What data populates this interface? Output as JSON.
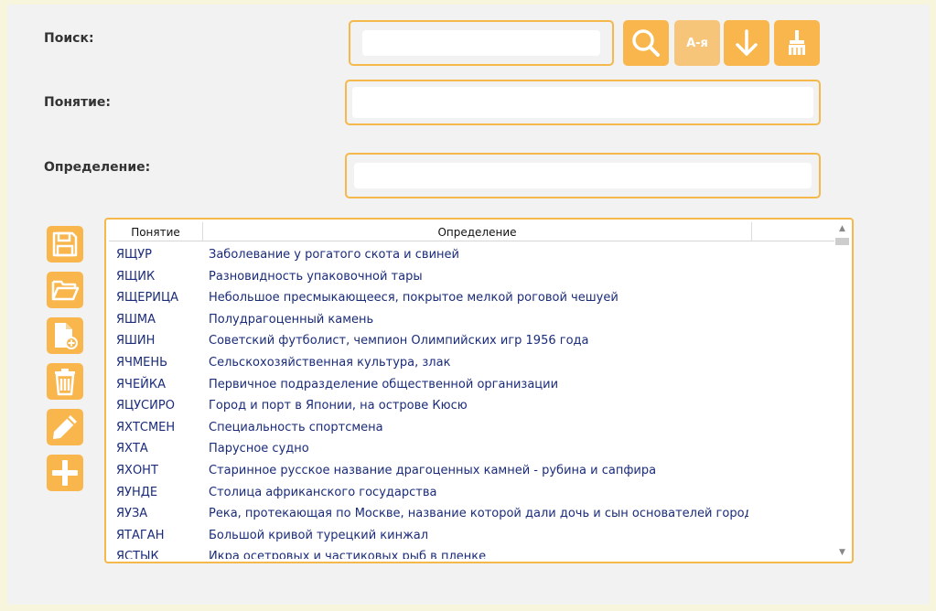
{
  "labels": {
    "search": "Поиск:",
    "concept": "Понятие:",
    "definition": "Определение:"
  },
  "inputs": {
    "search_value": "",
    "concept_value": "",
    "definition_value": ""
  },
  "toolbar": {
    "sort_label": "А-я",
    "search_icon": "magnifier-icon",
    "download_icon": "arrow-down-icon",
    "clear_icon": "broom-icon"
  },
  "sidebar_icons": [
    "save-icon",
    "open-folder-icon",
    "new-file-icon",
    "trash-icon",
    "pencil-icon",
    "plus-icon"
  ],
  "table": {
    "columns": [
      "Понятие",
      "Определение"
    ],
    "rows": [
      {
        "term": "ЯЩУР",
        "def": "Заболевание у рогатого скота и свиней"
      },
      {
        "term": "ЯЩИК",
        "def": "Разновидность упаковочной тары"
      },
      {
        "term": "ЯЩЕРИЦА",
        "def": "Небольшое пресмыкающееся, покрытое мелкой роговой чешуей"
      },
      {
        "term": "ЯШМА",
        "def": "Полудрагоценный камень"
      },
      {
        "term": "ЯШИН",
        "def": "Советский футболист, чемпион Олимпийских игр 1956 года"
      },
      {
        "term": "ЯЧМЕНЬ",
        "def": "Сельскохозяйственная культура, злак"
      },
      {
        "term": "ЯЧЕЙКА",
        "def": "Первичное подразделение общественной организации"
      },
      {
        "term": "ЯЦУСИРО",
        "def": "Город и порт в Японии, на острове Кюсю"
      },
      {
        "term": "ЯХТСМЕН",
        "def": "Специальность спортсмена"
      },
      {
        "term": "ЯХТА",
        "def": "Парусное судно"
      },
      {
        "term": "ЯХОНТ",
        "def": "Старинное русское название драгоценных камней - рубина и сапфира"
      },
      {
        "term": "ЯУНДЕ",
        "def": "Столица африканского государства"
      },
      {
        "term": "ЯУЗА",
        "def": "Река, протекающая по Москве, название которой дали дочь и сын основателей города Мо"
      },
      {
        "term": "ЯТАГАН",
        "def": "Большой кривой турецкий кинжал"
      },
      {
        "term": "ЯСТЫК",
        "def": "Икра осетровых и частиковых рыб в пленке"
      }
    ]
  },
  "colors": {
    "accent": "#f8b64c",
    "border": "#f5b84a",
    "background": "#f2f2f2",
    "text_rows": "#1a2b7a"
  }
}
